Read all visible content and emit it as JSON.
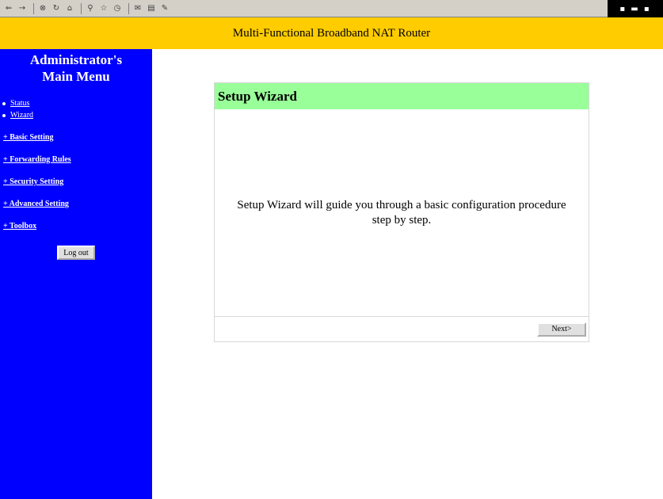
{
  "header": {
    "title": "Multi-Functional Broadband NAT Router"
  },
  "sidebar": {
    "title_line1": "Administrator's",
    "title_line2": "Main Menu",
    "sub_items": [
      {
        "label": "Status"
      },
      {
        "label": "Wizard"
      }
    ],
    "groups": [
      {
        "label": "+ Basic Setting"
      },
      {
        "label": "+ Forwarding Rules"
      },
      {
        "label": "+ Security Setting"
      },
      {
        "label": "+ Advanced Setting"
      },
      {
        "label": "+ Toolbox"
      }
    ],
    "logout_label": "Log out"
  },
  "wizard": {
    "title": "Setup Wizard",
    "body": "Setup Wizard will guide you through a basic configuration procedure step by step.",
    "next_label": "Next>"
  },
  "colors": {
    "header_bg": "#ffcc00",
    "sidebar_bg": "#0000ff",
    "wizard_header_bg": "#99ff99"
  }
}
